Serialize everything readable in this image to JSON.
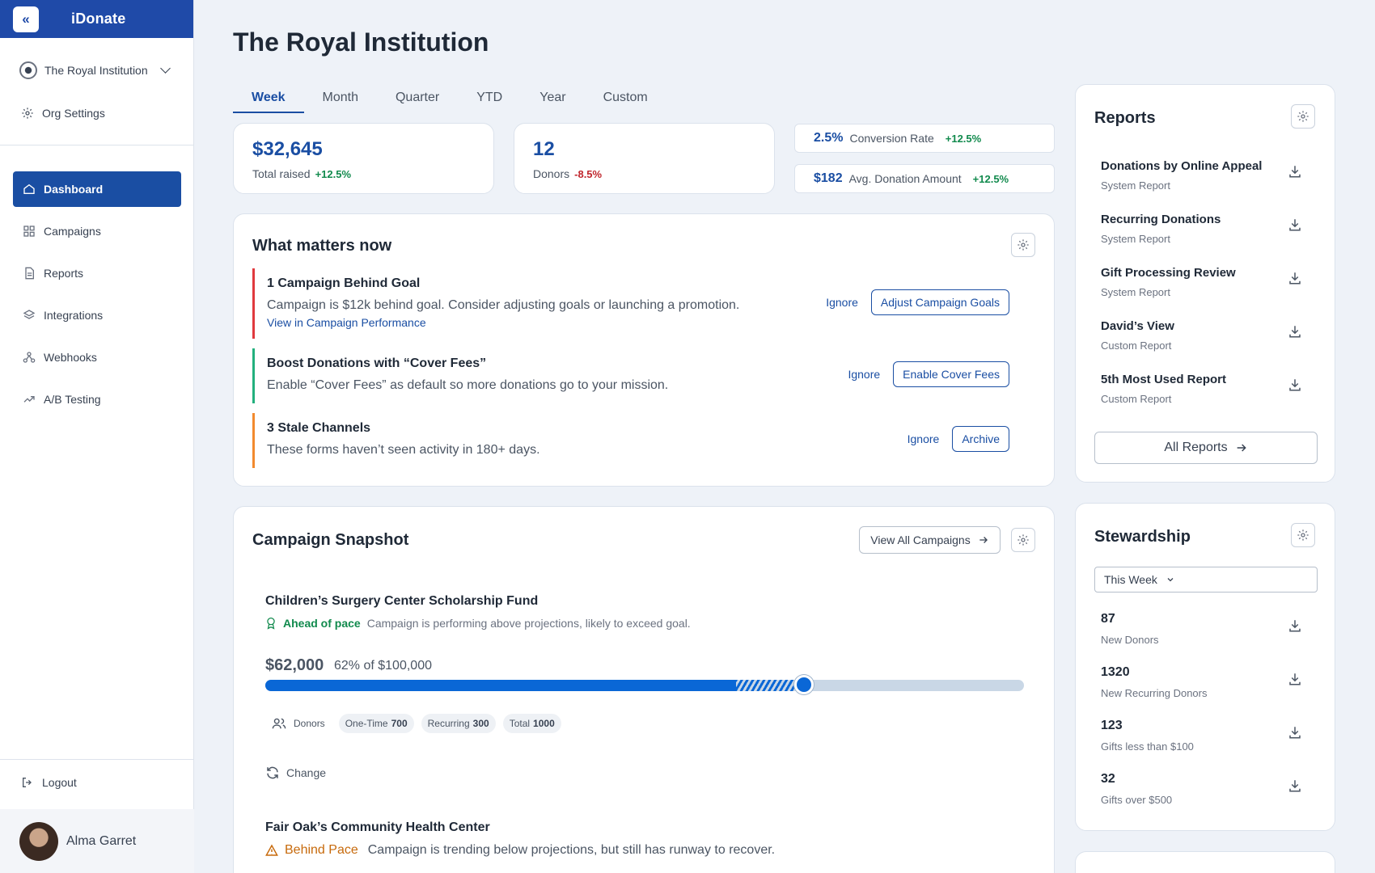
{
  "brand": {
    "name": "iDonate",
    "collapse_icon": "«"
  },
  "org": {
    "name": "The Royal Institution",
    "settings_label": "Org Settings"
  },
  "nav": [
    {
      "label": "Dashboard",
      "icon": "home-icon",
      "active": true
    },
    {
      "label": "Campaigns",
      "icon": "grid-icon"
    },
    {
      "label": "Reports",
      "icon": "document-icon"
    },
    {
      "label": "Integrations",
      "icon": "layers-icon"
    },
    {
      "label": "Webhooks",
      "icon": "webhook-icon"
    },
    {
      "label": "A/B Testing",
      "icon": "trend-icon"
    }
  ],
  "logout_label": "Logout",
  "user": {
    "name": "Alma Garret"
  },
  "page_title": "The Royal Institution",
  "tabs": [
    "Week",
    "Month",
    "Quarter",
    "YTD",
    "Year",
    "Custom"
  ],
  "active_tab": "Week",
  "stats": {
    "total_raised": {
      "value": "$32,645",
      "label": "Total raised",
      "change": "+12.5%"
    },
    "donors": {
      "value": "12",
      "label": "Donors",
      "change": "-8.5%"
    },
    "conversion": {
      "value": "2.5%",
      "label": "Conversion Rate",
      "change": "+12.5%"
    },
    "avg_donation": {
      "value": "$182",
      "label": "Avg. Donation Amount",
      "change": "+12.5%"
    }
  },
  "what_matters": {
    "title": "What matters now",
    "ignore_label": "Ignore",
    "alerts": [
      {
        "title": "1 Campaign Behind Goal",
        "desc": "Campaign is $12k behind goal. Consider adjusting goals or launching a promotion.",
        "link": "View in Campaign Performance",
        "action": "Adjust Campaign Goals",
        "color": "#e0393e"
      },
      {
        "title": "Boost Donations with “Cover Fees”",
        "desc": "Enable “Cover Fees” as default so more donations go to your mission.",
        "action": "Enable Cover Fees",
        "color": "#23b07d"
      },
      {
        "title": "3 Stale Channels",
        "desc": "These forms haven’t seen activity in 180+ days.",
        "action": "Archive",
        "color": "#f28a2e"
      }
    ]
  },
  "snapshot": {
    "title": "Campaign Snapshot",
    "view_all_label": "View All Campaigns",
    "campaigns": [
      {
        "name": "Children’s Surgery Center Scholarship Fund",
        "status": "Ahead of pace",
        "status_desc": "Campaign is performing above projections, likely to exceed goal.",
        "status_color": "#118a4d",
        "amount": "$62,000",
        "amount_of": "62% of $100,000",
        "progress": 0.62,
        "projected": 0.71,
        "donors_label": "Donors",
        "chips": [
          {
            "label": "One-Time",
            "value": "700"
          },
          {
            "label": "Recurring",
            "value": "300"
          },
          {
            "label": "Total",
            "value": "1000"
          }
        ],
        "change_label": "Change"
      },
      {
        "name": "Fair Oak’s Community Health Center",
        "status": "Behind Pace",
        "status_desc": "Campaign is trending below projections, but still has runway to recover.",
        "status_color": "#c76a0c"
      }
    ]
  },
  "reports": {
    "title": "Reports",
    "items": [
      {
        "name": "Donations by Online Appeal",
        "type": "System Report"
      },
      {
        "name": "Recurring Donations",
        "type": "System Report"
      },
      {
        "name": "Gift Processing Review",
        "type": "System Report"
      },
      {
        "name": "David’s View",
        "type": "Custom Report"
      },
      {
        "name": "5th Most Used Report",
        "type": "Custom Report"
      }
    ],
    "all_label": "All Reports"
  },
  "stewardship": {
    "title": "Stewardship",
    "period": "This Week",
    "items": [
      {
        "value": "87",
        "label": "New Donors"
      },
      {
        "value": "1320",
        "label": "New Recurring Donors"
      },
      {
        "value": "123",
        "label": "Gifts less than $100"
      },
      {
        "value": "32",
        "label": "Gifts over $500"
      }
    ]
  },
  "colors": {
    "brand": "#1f4aa8",
    "accent": "#1a4ea3",
    "positive": "#118a4d",
    "negative": "#c0262d"
  }
}
